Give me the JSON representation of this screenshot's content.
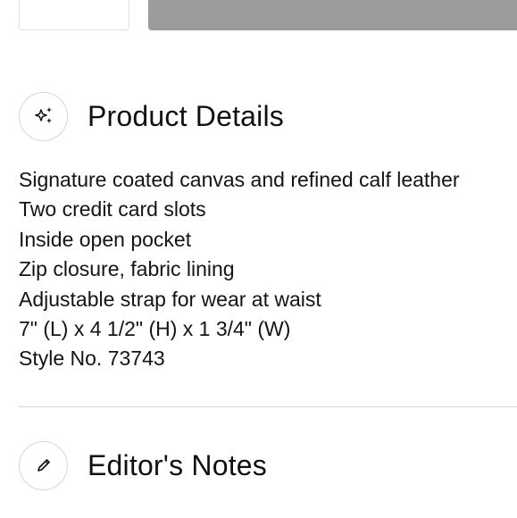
{
  "product_details": {
    "title": "Product Details",
    "icon": "sparkle-icon",
    "toggle_icon": "minus-icon",
    "items": [
      "Signature coated canvas and refined calf leather",
      "Two credit card slots",
      "Inside open pocket",
      "Zip closure, fabric lining",
      "Adjustable strap for wear at waist",
      "7\" (L) x 4 1/2\" (H) x 1 3/4\" (W)",
      "Style No. 73743"
    ]
  },
  "editors_notes": {
    "title": "Editor's Notes",
    "icon": "pencil-icon",
    "toggle_icon": "plus-icon"
  }
}
